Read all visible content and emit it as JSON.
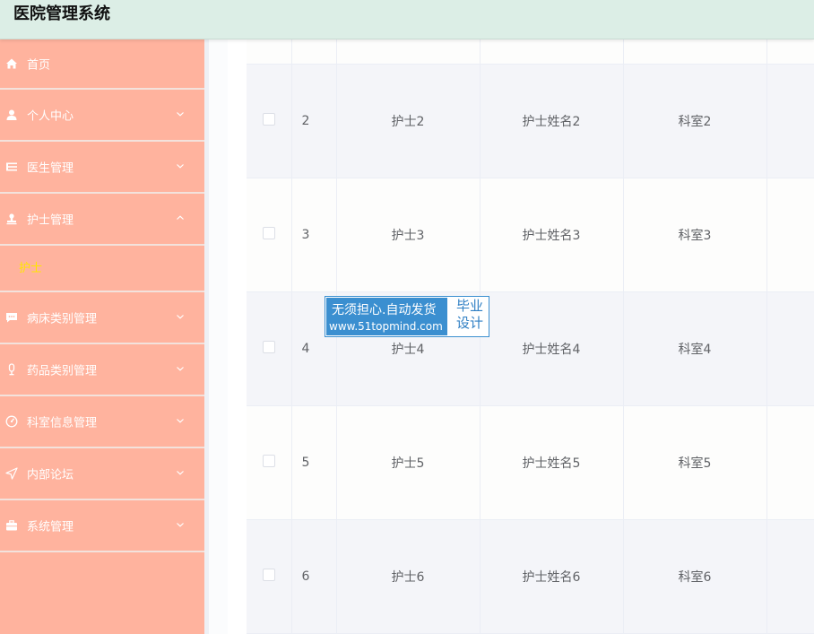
{
  "app": {
    "title": "医院管理系统"
  },
  "sidebar": {
    "items": [
      {
        "label": "首页",
        "icon": "home-icon",
        "expandable": false
      },
      {
        "label": "个人中心",
        "icon": "user-icon",
        "expandable": true,
        "expanded": false
      },
      {
        "label": "医生管理",
        "icon": "list-icon",
        "expandable": true,
        "expanded": false
      },
      {
        "label": "护士管理",
        "icon": "stamp-icon",
        "expandable": true,
        "expanded": true,
        "children": [
          {
            "label": "护士"
          }
        ]
      },
      {
        "label": "病床类别管理",
        "icon": "chat-icon",
        "expandable": true,
        "expanded": false
      },
      {
        "label": "药品类别管理",
        "icon": "microphone-icon",
        "expandable": true,
        "expanded": false
      },
      {
        "label": "科室信息管理",
        "icon": "gauge-icon",
        "expandable": true,
        "expanded": false
      },
      {
        "label": "内部论坛",
        "icon": "send-icon",
        "expandable": true,
        "expanded": false
      },
      {
        "label": "系统管理",
        "icon": "briefcase-icon",
        "expandable": true,
        "expanded": false
      }
    ]
  },
  "table": {
    "rows": [
      {
        "index": "2",
        "account": "护士2",
        "name": "护士姓名2",
        "department": "科室2"
      },
      {
        "index": "3",
        "account": "护士3",
        "name": "护士姓名3",
        "department": "科室3"
      },
      {
        "index": "4",
        "account": "护士4",
        "name": "护士姓名4",
        "department": "科室4"
      },
      {
        "index": "5",
        "account": "护士5",
        "name": "护士姓名5",
        "department": "科室5"
      },
      {
        "index": "6",
        "account": "护士6",
        "name": "护士姓名6",
        "department": "科室6"
      }
    ]
  },
  "watermark": {
    "line1": "无须担心.自动发货",
    "line2": "www.51topmind.com",
    "side_top": "毕业",
    "side_bottom": "设计"
  },
  "colors": {
    "header_bg": "#dceee6",
    "sidebar_bg": "#ffb39e",
    "submenu_active_text": "#ffe600",
    "row_stripe": "#f4f5f9",
    "watermark_blue": "#3b8fd0"
  }
}
